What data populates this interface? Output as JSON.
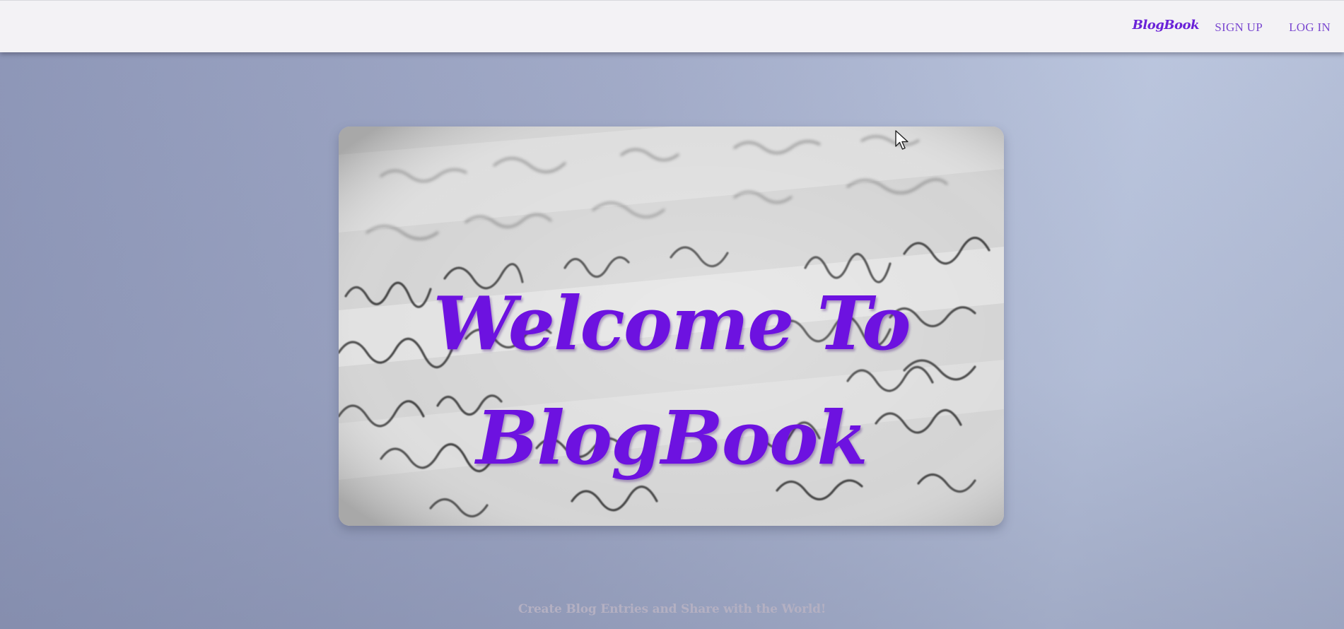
{
  "navbar": {
    "brand": "BlogBook",
    "links": [
      {
        "label": "SIGN UP"
      },
      {
        "label": "LOG IN"
      }
    ]
  },
  "hero": {
    "title_line1": "Welcome To",
    "title_line2": "BlogBook",
    "background_image": "handwritten-letter-image",
    "title_color": "#6d12e0"
  },
  "tagline": "Create Blog Entries and Share with the World!",
  "colors": {
    "brand": "#6a22d8",
    "nav_link": "#7a48d0",
    "navbar_bg": "#f3f2f5",
    "page_bg": "#a3acc9"
  },
  "icons": {
    "cursor": "mouse-pointer-icon"
  }
}
